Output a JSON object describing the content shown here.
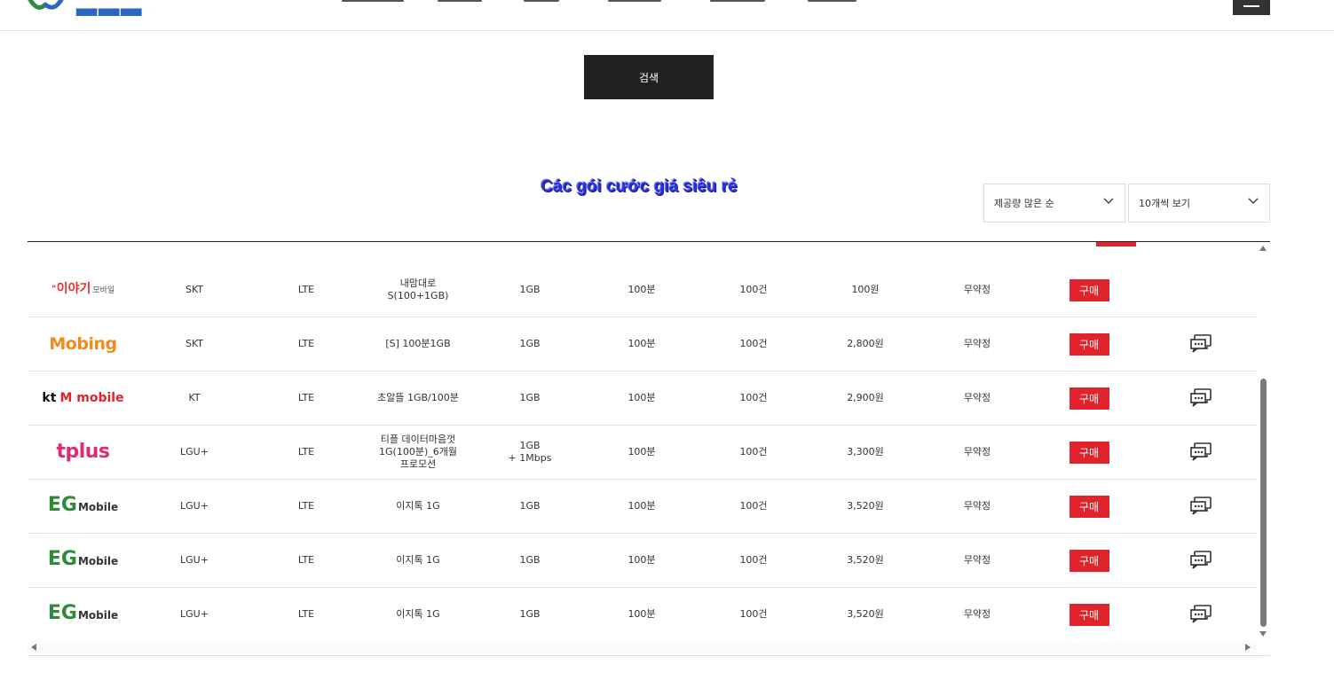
{
  "search": {
    "button_label": "검색"
  },
  "section": {
    "title": "Các gói cước giá siêu rẻ"
  },
  "filters": {
    "sort_selected": "제공량 많은 순",
    "page_size_selected": "10개씩 보기"
  },
  "plans": [
    {
      "brand": "이야기",
      "brand_sub": "모바일",
      "carrier": "SKT",
      "network": "LTE",
      "plan": "내맘대로S(100+1GB)",
      "data": "1GB",
      "data_extra": "",
      "voice": "100분",
      "sms": "100건",
      "price": "100원",
      "contract": "무약정",
      "buy_label": "구매",
      "has_consult": false
    },
    {
      "brand": "Mobing",
      "brand_sub": "",
      "carrier": "SKT",
      "network": "LTE",
      "plan": "[S] 100분1GB",
      "data": "1GB",
      "data_extra": "",
      "voice": "100분",
      "sms": "100건",
      "price": "2,800원",
      "contract": "무약정",
      "buy_label": "구매",
      "has_consult": true
    },
    {
      "brand": "kt",
      "brand_sub": "M mobile",
      "carrier": "KT",
      "network": "LTE",
      "plan": "초알뜰 1GB/100분",
      "data": "1GB",
      "data_extra": "",
      "voice": "100분",
      "sms": "100건",
      "price": "2,900원",
      "contract": "무약정",
      "buy_label": "구매",
      "has_consult": true
    },
    {
      "brand": "tplus",
      "brand_sub": "",
      "carrier": "LGU+",
      "network": "LTE",
      "plan": "티플 데이터마음껏1G(100분)_6개월 프로모션",
      "data": "1GB",
      "data_extra": "+ 1Mbps",
      "voice": "100분",
      "sms": "100건",
      "price": "3,300원",
      "contract": "무약정",
      "buy_label": "구매",
      "has_consult": true
    },
    {
      "brand": "EG",
      "brand_sub": "Mobile",
      "carrier": "LGU+",
      "network": "LTE",
      "plan": "이지톡 1G",
      "data": "1GB",
      "data_extra": "",
      "voice": "100분",
      "sms": "100건",
      "price": "3,520원",
      "contract": "무약정",
      "buy_label": "구매",
      "has_consult": true
    },
    {
      "brand": "EG",
      "brand_sub": "Mobile",
      "carrier": "LGU+",
      "network": "LTE",
      "plan": "이지톡 1G",
      "data": "1GB",
      "data_extra": "",
      "voice": "100분",
      "sms": "100건",
      "price": "3,520원",
      "contract": "무약정",
      "buy_label": "구매",
      "has_consult": true
    },
    {
      "brand": "EG",
      "brand_sub": "Mobile",
      "carrier": "LGU+",
      "network": "LTE",
      "plan": "이지톡 1G",
      "data": "1GB",
      "data_extra": "",
      "voice": "100분",
      "sms": "100건",
      "price": "3,520원",
      "contract": "무약정",
      "buy_label": "구매",
      "has_consult": true
    }
  ],
  "colors": {
    "accent_red": "#e1242b",
    "title_blue": "#2733d8",
    "dark": "#222222"
  },
  "icons": {
    "consult": "chat-bubbles-icon",
    "select": "chevron-down-icon",
    "menu": "hamburger-icon"
  }
}
